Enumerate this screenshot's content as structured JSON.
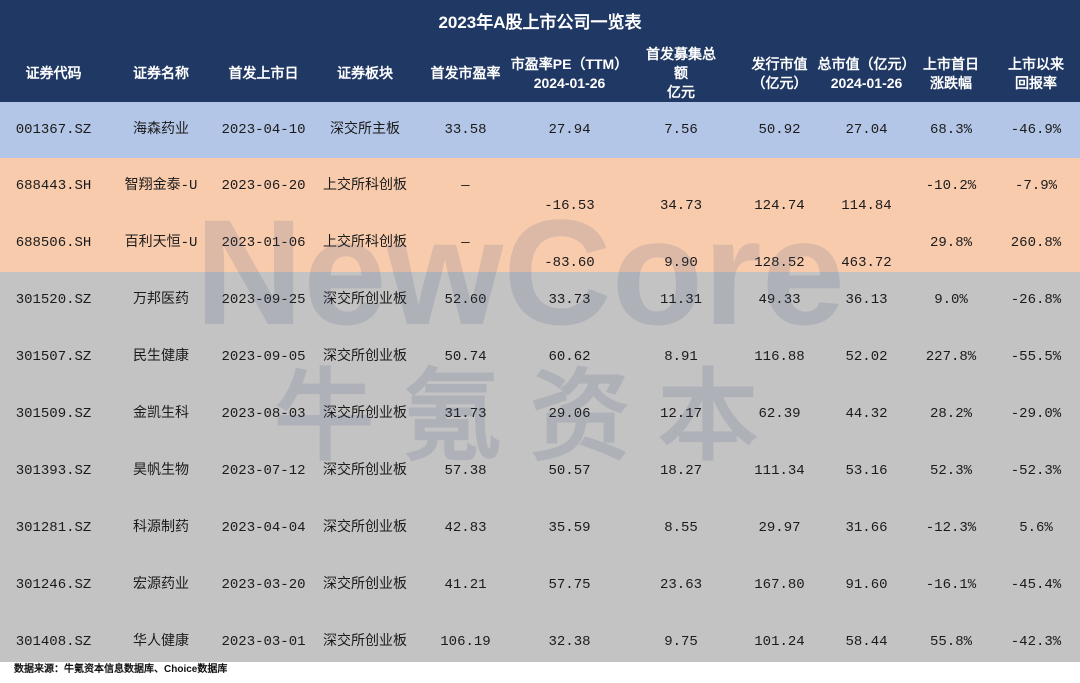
{
  "colors": {
    "header_bg": "#203864",
    "header_text": "#ffffff",
    "cell_text": "#1b1b1b"
  },
  "chart_data": {
    "type": "table",
    "title": "2023年A股上市公司一览表",
    "columns": [
      {
        "lines": [
          "证券代码"
        ]
      },
      {
        "lines": [
          "证券名称"
        ]
      },
      {
        "lines": [
          "首发上市日"
        ]
      },
      {
        "lines": [
          "证券板块"
        ]
      },
      {
        "lines": [
          "首发市盈率"
        ]
      },
      {
        "lines": [
          "市盈率PE（TTM）",
          "2024-01-26"
        ]
      },
      {
        "lines": [
          "首发募集总额",
          "亿元"
        ]
      },
      {
        "lines": [
          "发行市值",
          "（亿元）"
        ]
      },
      {
        "lines": [
          "总市值（亿元）",
          "2024-01-26"
        ]
      },
      {
        "lines": [
          "上市首日",
          "涨跌幅"
        ]
      },
      {
        "lines": [
          "上市以来",
          "回报率"
        ]
      }
    ],
    "groups": [
      {
        "color": "#b4c6e7",
        "rows": [
          [
            "001367.SZ",
            "海森药业",
            "2023-04-10",
            "深交所主板",
            "33.58",
            "27.94",
            "7.56",
            "50.92",
            "27.04",
            "68.3%",
            "-46.9%"
          ]
        ]
      },
      {
        "color": "#f8cbad",
        "rows": [
          [
            "688443.SH",
            "智翔金泰-U",
            "2023-06-20",
            "上交所科创板",
            "—",
            "-16.53",
            "34.73",
            "124.74",
            "114.84",
            "-10.2%",
            "-7.9%"
          ],
          [
            "688506.SH",
            "百利天恒-U",
            "2023-01-06",
            "上交所科创板",
            "—",
            "-83.60",
            "9.90",
            "128.52",
            "463.72",
            "29.8%",
            "260.8%"
          ]
        ]
      },
      {
        "color": "#c3c3c3",
        "rows": [
          [
            "301520.SZ",
            "万邦医药",
            "2023-09-25",
            "深交所创业板",
            "52.60",
            "33.73",
            "11.31",
            "49.33",
            "36.13",
            "9.0%",
            "-26.8%"
          ],
          [
            "301507.SZ",
            "民生健康",
            "2023-09-05",
            "深交所创业板",
            "50.74",
            "60.62",
            "8.91",
            "116.88",
            "52.02",
            "227.8%",
            "-55.5%"
          ],
          [
            "301509.SZ",
            "金凯生科",
            "2023-08-03",
            "深交所创业板",
            "31.73",
            "29.06",
            "12.17",
            "62.39",
            "44.32",
            "28.2%",
            "-29.0%"
          ],
          [
            "301393.SZ",
            "昊帆生物",
            "2023-07-12",
            "深交所创业板",
            "57.38",
            "50.57",
            "18.27",
            "111.34",
            "53.16",
            "52.3%",
            "-52.3%"
          ],
          [
            "301281.SZ",
            "科源制药",
            "2023-04-04",
            "深交所创业板",
            "42.83",
            "35.59",
            "8.55",
            "29.97",
            "31.66",
            "-12.3%",
            "5.6%"
          ],
          [
            "301246.SZ",
            "宏源药业",
            "2023-03-20",
            "深交所创业板",
            "41.21",
            "57.75",
            "23.63",
            "167.80",
            "91.60",
            "-16.1%",
            "-45.4%"
          ],
          [
            "301408.SZ",
            "华人健康",
            "2023-03-01",
            "深交所创业板",
            "106.19",
            "32.38",
            "9.75",
            "101.24",
            "58.44",
            "55.8%",
            "-42.3%"
          ]
        ]
      }
    ]
  },
  "watermark": {
    "latin": "NewCore",
    "cjk": "牛氪资本"
  },
  "footer": {
    "source": "数据来源：牛氪资本信息数据库、Choice数据库"
  }
}
